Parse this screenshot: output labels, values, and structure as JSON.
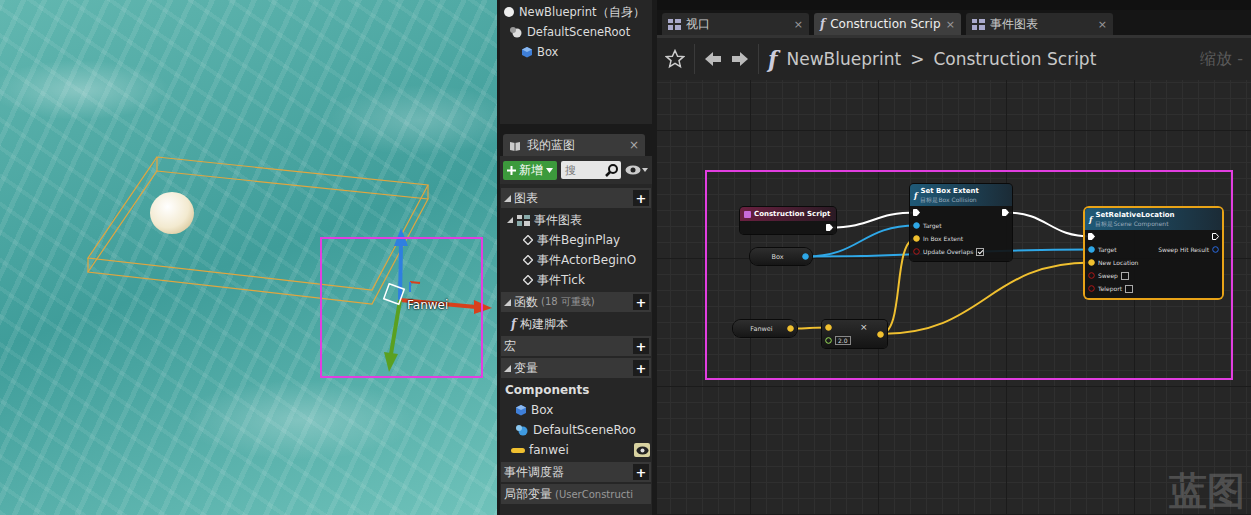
{
  "viewport": {
    "actor_label": "Fanwei"
  },
  "components": [
    {
      "label": "NewBlueprint（自身）",
      "kind": "self"
    },
    {
      "label": "DefaultSceneRoot",
      "kind": "scene"
    },
    {
      "label": "Box",
      "kind": "box"
    }
  ],
  "my_blueprint": {
    "tab": {
      "label": "我的蓝图",
      "close": "×"
    },
    "add_button": "新增",
    "search_placeholder": "搜",
    "sections": [
      {
        "title": "图表",
        "expanded": true,
        "add": "+",
        "items": [
          {
            "label": "事件图表",
            "kind": "graph",
            "expanded": true
          },
          {
            "label": "事件BeginPlay",
            "kind": "event"
          },
          {
            "label": "事件ActorBeginO",
            "kind": "event"
          },
          {
            "label": "事件Tick",
            "kind": "event"
          }
        ]
      },
      {
        "title": "函数",
        "count": "(18 可重载)",
        "expanded": true,
        "add": "+",
        "items": [
          {
            "label": "构建脚本",
            "kind": "function"
          }
        ]
      },
      {
        "title": "宏",
        "expanded": false,
        "add": "+",
        "items": []
      },
      {
        "title": "变量",
        "expanded": true,
        "add": "+",
        "items": [
          {
            "label": "Components",
            "kind": "category"
          },
          {
            "label": "Box",
            "kind": "box"
          },
          {
            "label": "DefaultSceneRoo",
            "kind": "scene"
          },
          {
            "label": "fanwei",
            "kind": "variable",
            "visible": true
          }
        ]
      },
      {
        "title": "事件调度器",
        "expanded": false,
        "add": "+",
        "items": []
      },
      {
        "title": "局部变量",
        "count": "(UserConstructi",
        "expanded": false,
        "items": []
      }
    ]
  },
  "function_glyph": "f",
  "editor_tabs": [
    {
      "label": "视口",
      "kind": "viewport",
      "selected": false,
      "close": "×"
    },
    {
      "label": "Construction Scrip",
      "kind": "function",
      "selected": true,
      "close": "×"
    },
    {
      "label": "事件图表",
      "kind": "graph",
      "selected": false,
      "close": "×"
    }
  ],
  "breadcrumb": {
    "path": [
      "NewBlueprint",
      "Construction Script"
    ],
    "separator": ">",
    "zoom": "缩放 -"
  },
  "graph": {
    "nodes": [
      {
        "kind": "event",
        "title": "Construction Script",
        "selected": false,
        "pins": [
          {
            "side": "out",
            "type": "exec",
            "label": ""
          }
        ]
      },
      {
        "kind": "function",
        "title": "Set Box Extent",
        "subtitle": "目标是Box Collision",
        "selected": false,
        "pins": [
          {
            "side": "in",
            "type": "exec",
            "label": ""
          },
          {
            "side": "in",
            "type": "object",
            "label": "Target"
          },
          {
            "side": "in",
            "type": "vector",
            "label": "In Box Extent"
          },
          {
            "side": "in",
            "type": "bool",
            "label": "Update Overlaps",
            "checked": true
          },
          {
            "side": "out",
            "type": "exec",
            "label": ""
          }
        ]
      },
      {
        "kind": "function",
        "title": "SetRelativeLocation",
        "subtitle": "目标是Scene Component",
        "selected": true,
        "pins": [
          {
            "side": "in",
            "type": "exec",
            "label": ""
          },
          {
            "side": "in",
            "type": "object",
            "label": "Target"
          },
          {
            "side": "in",
            "type": "vector",
            "label": "New Location"
          },
          {
            "side": "in",
            "type": "bool",
            "label": "Sweep",
            "checked": false
          },
          {
            "side": "in",
            "type": "bool",
            "label": "Teleport",
            "checked": false
          },
          {
            "side": "out",
            "type": "exec",
            "label": ""
          },
          {
            "side": "out",
            "type": "struct",
            "label": "Sweep Hit Result"
          }
        ]
      },
      {
        "kind": "variable",
        "title": "Box",
        "selected": false,
        "pins": [
          {
            "side": "out",
            "type": "object",
            "label": ""
          }
        ]
      },
      {
        "kind": "variable",
        "title": "Fanwei",
        "selected": false,
        "pins": [
          {
            "side": "out",
            "type": "vector",
            "label": ""
          }
        ]
      },
      {
        "kind": "math",
        "title": "×",
        "selected": false,
        "pins": [
          {
            "side": "in",
            "type": "vector",
            "label": ""
          },
          {
            "side": "in",
            "type": "float",
            "label": "",
            "value": "2.0"
          },
          {
            "side": "out",
            "type": "vector",
            "label": ""
          }
        ]
      }
    ],
    "links": [
      {
        "from": [
          0,
          0
        ],
        "to": [
          1,
          0
        ]
      },
      {
        "from": [
          1,
          4
        ],
        "to": [
          2,
          0
        ]
      },
      {
        "from": [
          3,
          0
        ],
        "to": [
          1,
          1
        ]
      },
      {
        "from": [
          3,
          0
        ],
        "to": [
          2,
          1
        ]
      },
      {
        "from": [
          5,
          2
        ],
        "to": [
          1,
          2
        ]
      },
      {
        "from": [
          5,
          2
        ],
        "to": [
          2,
          2
        ]
      },
      {
        "from": [
          4,
          0
        ],
        "to": [
          5,
          0
        ]
      }
    ]
  },
  "watermark": "蓝图"
}
